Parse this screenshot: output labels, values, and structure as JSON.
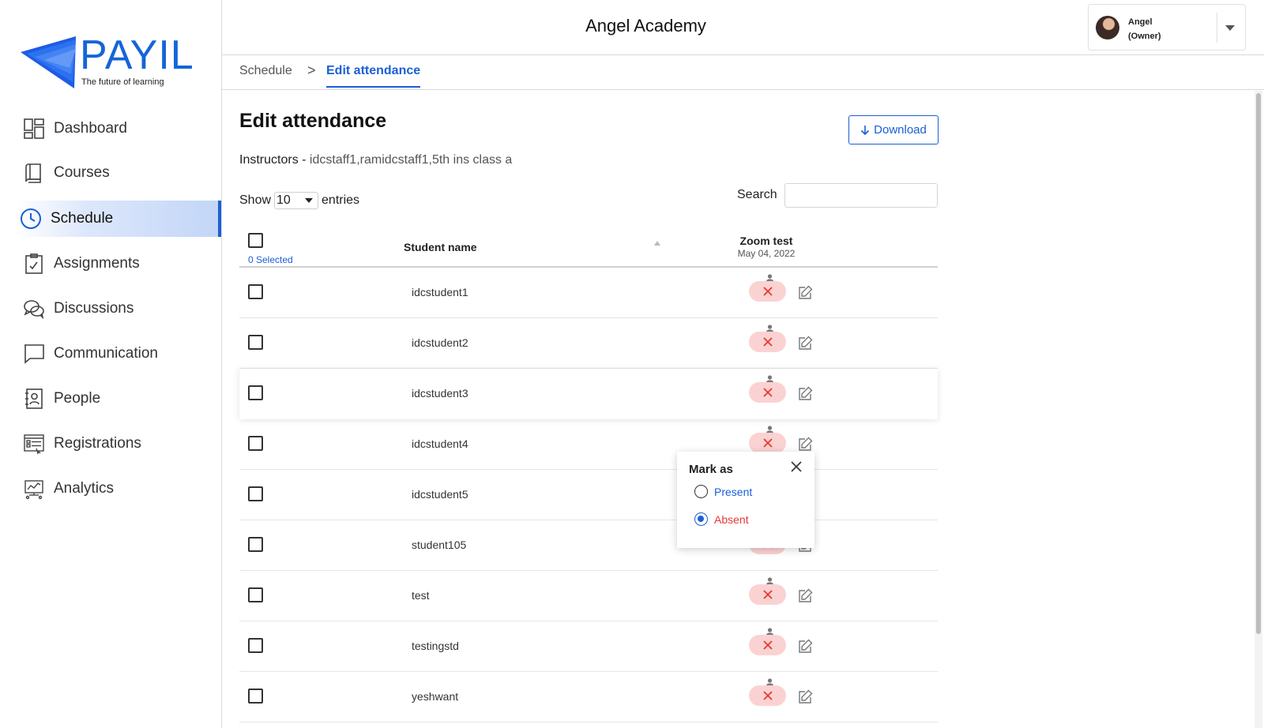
{
  "brand": {
    "name": "PAYIL",
    "tagline": "The future of learning",
    "color": "#1565d8"
  },
  "sidebar": {
    "items": [
      {
        "label": "Dashboard",
        "icon": "dashboard-icon"
      },
      {
        "label": "Courses",
        "icon": "book-icon"
      },
      {
        "label": "Schedule",
        "icon": "clock-icon",
        "active": true
      },
      {
        "label": "Assignments",
        "icon": "clipboard-icon"
      },
      {
        "label": "Discussions",
        "icon": "chat-bubbles-icon"
      },
      {
        "label": "Communication",
        "icon": "message-icon"
      },
      {
        "label": "People",
        "icon": "contact-book-icon"
      },
      {
        "label": "Registrations",
        "icon": "registration-form-icon"
      },
      {
        "label": "Analytics",
        "icon": "analytics-icon"
      }
    ]
  },
  "header": {
    "title": "Angel Academy",
    "user": {
      "name": "Angel",
      "role": "(Owner)"
    }
  },
  "breadcrumb": {
    "parent": "Schedule",
    "separator": ">",
    "current": "Edit attendance"
  },
  "page": {
    "title": "Edit attendance",
    "download_label": "Download",
    "instructors_label": "Instructors - ",
    "instructors_value": "idcstaff1,ramidcstaff1,5th ins class a",
    "show_label": "Show",
    "entries_value": "10",
    "entries_label": "entries",
    "search_label": "Search",
    "search_value": ""
  },
  "table": {
    "selected_label": "0 Selected",
    "columns": {
      "name": "Student name",
      "session": "Zoom test",
      "date": "May 04, 2022"
    },
    "rows": [
      {
        "name": "idcstudent1",
        "status": "absent"
      },
      {
        "name": "idcstudent2",
        "status": "absent"
      },
      {
        "name": "idcstudent3",
        "status": "absent"
      },
      {
        "name": "idcstudent4",
        "status": "absent"
      },
      {
        "name": "idcstudent5",
        "status": "absent"
      },
      {
        "name": "student105",
        "status": "absent"
      },
      {
        "name": "test",
        "status": "absent"
      },
      {
        "name": "testingstd",
        "status": "absent"
      },
      {
        "name": "yeshwant",
        "status": "absent"
      }
    ]
  },
  "popup": {
    "title": "Mark as",
    "options": [
      {
        "label": "Present",
        "color": "#1a5fd6",
        "selected": false
      },
      {
        "label": "Absent",
        "color": "#e53935",
        "selected": true
      }
    ]
  },
  "colors": {
    "accent": "#1a5fd6",
    "absent_bg": "#fbd2d2",
    "absent_x": "#e53935"
  }
}
